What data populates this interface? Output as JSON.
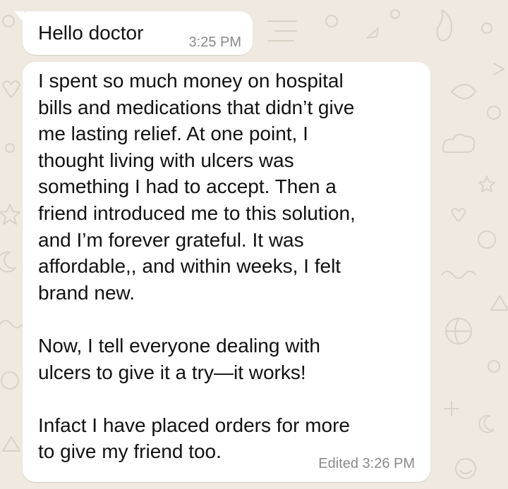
{
  "colors": {
    "wallpaper": "#efe9e0",
    "doodle": "#d9d2c5",
    "bubble": "#ffffff",
    "text": "#111111",
    "meta": "#8a8a8a"
  },
  "messages": [
    {
      "text": "Hello doctor",
      "time": "3:25 PM"
    },
    {
      "text": "I spent so much money on hospital\nbills and medications that didn’t give\nme lasting relief. At one point, I\nthought living with ulcers was\nsomething I had to accept. Then a\nfriend introduced me to this solution,\nand I’m forever grateful. It was\naffordable,, and within weeks, I felt\nbrand new.\n\n Now, I tell everyone dealing with\nulcers to give it a try—it works!\n\nInfact I have placed orders for more\nto give my friend too.",
      "status": "Edited 3:26 PM"
    }
  ]
}
